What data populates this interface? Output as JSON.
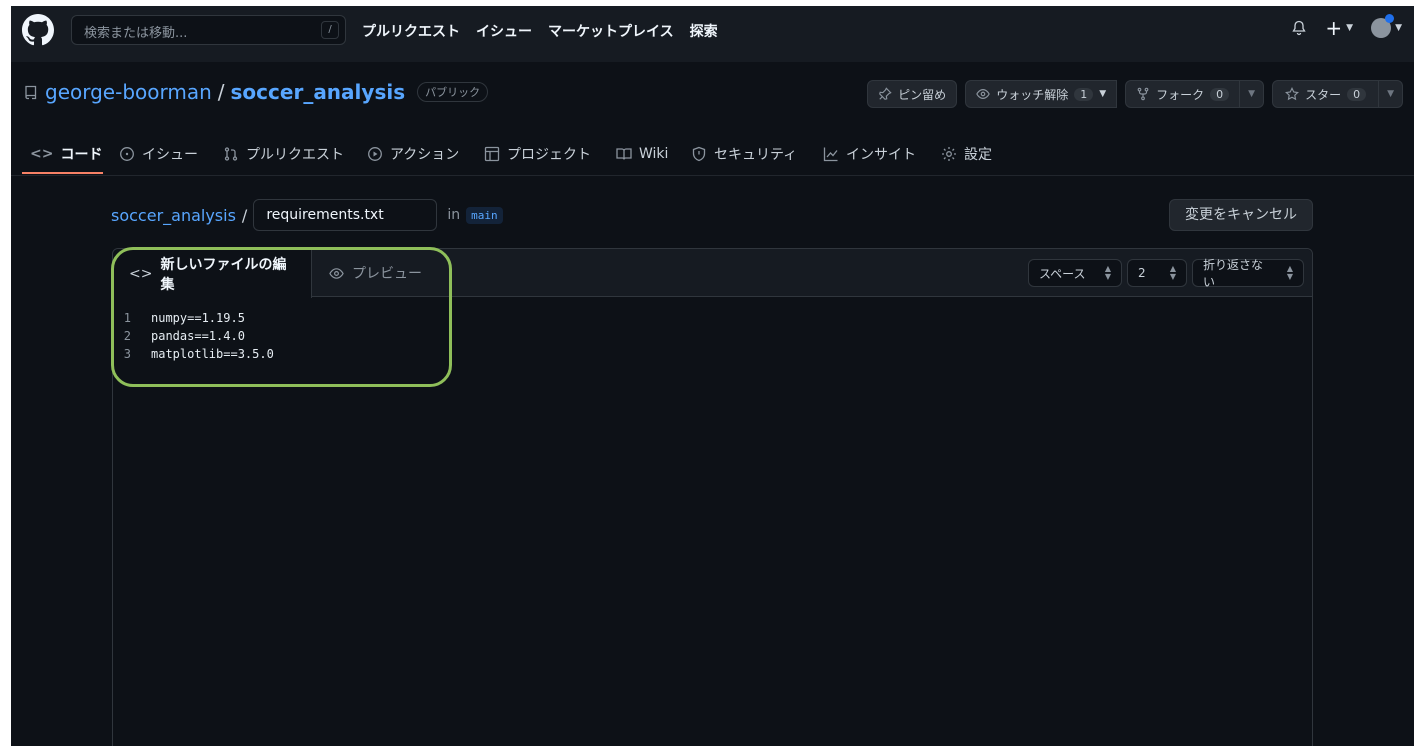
{
  "topbar": {
    "search_placeholder": "検索または移動...",
    "slash_key": "/",
    "nav": [
      "プルリクエスト",
      "イシュー",
      "マーケットプレイス",
      "探索"
    ],
    "plus": "+"
  },
  "repo": {
    "owner": "george-boorman",
    "separator": "/",
    "name": "soccer_analysis",
    "visibility": "パブリック",
    "pin_label": "ピン留め",
    "watch_label": "ウォッチ解除",
    "watch_count": "1",
    "fork_label": "フォーク",
    "fork_count": "0",
    "star_label": "スター",
    "star_count": "0"
  },
  "tabs": [
    {
      "label": "コード",
      "icon": "code-icon"
    },
    {
      "label": "イシュー",
      "icon": "issue-icon"
    },
    {
      "label": "プルリクエスト",
      "icon": "pull-request-icon"
    },
    {
      "label": "アクション",
      "icon": "play-icon"
    },
    {
      "label": "プロジェクト",
      "icon": "table-icon"
    },
    {
      "label": "Wiki",
      "icon": "book-icon"
    },
    {
      "label": "セキュリティ",
      "icon": "shield-icon"
    },
    {
      "label": "インサイト",
      "icon": "graph-icon"
    },
    {
      "label": "設定",
      "icon": "gear-icon"
    }
  ],
  "editor": {
    "crumb": "soccer_analysis",
    "crumb_sep": "/",
    "filename": "requirements.txt",
    "in_label": "in",
    "branch": "main",
    "cancel_label": "変更をキャンセル",
    "edit_tab": "新しいファイルの編集",
    "preview_tab": "プレビュー",
    "indent_mode": "スペース",
    "indent_size": "2",
    "wrap_mode": "折り返さない",
    "lines": [
      {
        "n": "1",
        "text": "numpy==1.19.5"
      },
      {
        "n": "2",
        "text": "pandas==1.4.0"
      },
      {
        "n": "3",
        "text": "matplotlib==3.5.0"
      }
    ]
  },
  "colors": {
    "background": "#0d1117",
    "header": "#161b22",
    "link": "#58a6ff",
    "tab_underline": "#f78166",
    "highlight": "#8fbf5a"
  }
}
